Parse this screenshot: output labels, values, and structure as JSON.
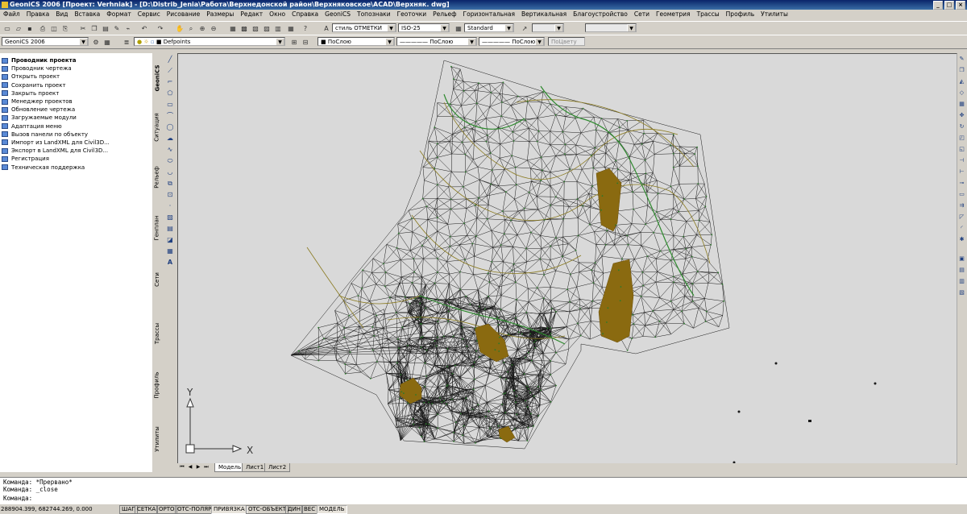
{
  "window": {
    "title": "GeoniCS 2006 [Проект: Verhniak] - [D:\\Distrib_Jenia\\Работа\\Верхнедонской район\\Верхняковское\\ACAD\\Верхняк. dwg]"
  },
  "menu": [
    "Файл",
    "Правка",
    "Вид",
    "Вставка",
    "Формат",
    "Сервис",
    "Рисование",
    "Размеры",
    "Редакт",
    "Окно",
    "Справка",
    "GeoniCS",
    "Топознаки",
    "Геоточки",
    "Рельеф",
    "Горизонтальная",
    "Вертикальная",
    "Благоустройство",
    "Сети",
    "Геометрия",
    "Трассы",
    "Профиль",
    "Утилиты"
  ],
  "toolbar1": {
    "text_style": "стиль ОТМЕТКИ",
    "dim_style": "ISO-25",
    "table_style": "Standard"
  },
  "toolbar2": {
    "workspace": "GeoniCS 2006",
    "layer": "Defpoints",
    "color": "ПоСлою",
    "linetype": "ПоСлою",
    "lineweight": "ПоСлою",
    "plotstyle": "ПоЦвету"
  },
  "tree": [
    {
      "label": "Проводник проекта",
      "selected": true
    },
    {
      "label": "Проводник чертежа"
    },
    {
      "label": "Открыть проект"
    },
    {
      "label": "Сохранить проект"
    },
    {
      "label": "Закрыть проект"
    },
    {
      "label": "Менеджер проектов"
    },
    {
      "label": "Обновление чертежа"
    },
    {
      "label": "Загружаемые модули"
    },
    {
      "label": "Адаптация меню"
    },
    {
      "label": "Вызов панели по объекту"
    },
    {
      "label": "Импорт из LandXML для Civil3D..."
    },
    {
      "label": "Экспорт в LandXML для Civil3D..."
    },
    {
      "label": "Регистрация"
    },
    {
      "label": "Техническая поддержка"
    }
  ],
  "side_tabs": [
    "GeoniCS",
    "Ситуация",
    "Рельеф",
    "Генплан",
    "Сети",
    "Трассы",
    "Профиль",
    "Утилиты"
  ],
  "layout_tabs": [
    "Модель",
    "Лист1",
    "Лист2"
  ],
  "ucs": {
    "x_label": "X",
    "y_label": "Y"
  },
  "command": {
    "lines": [
      "Команда: *Прервано*",
      "Команда: _close",
      "Команда:"
    ]
  },
  "status": {
    "coords": "288904.399, 682744.269, 0.000",
    "buttons": [
      {
        "label": "ШАГ",
        "on": false
      },
      {
        "label": "СЕТКА",
        "on": false
      },
      {
        "label": "ОРТО",
        "on": false
      },
      {
        "label": "ОТС-ПОЛЯР",
        "on": false
      },
      {
        "label": "ПРИВЯЗКА",
        "on": true
      },
      {
        "label": "ОТС-ОБЪЕКТ",
        "on": false
      },
      {
        "label": "ДИН",
        "on": false
      },
      {
        "label": "ВЕС",
        "on": false
      },
      {
        "label": "МОДЕЛЬ",
        "on": true
      }
    ]
  }
}
